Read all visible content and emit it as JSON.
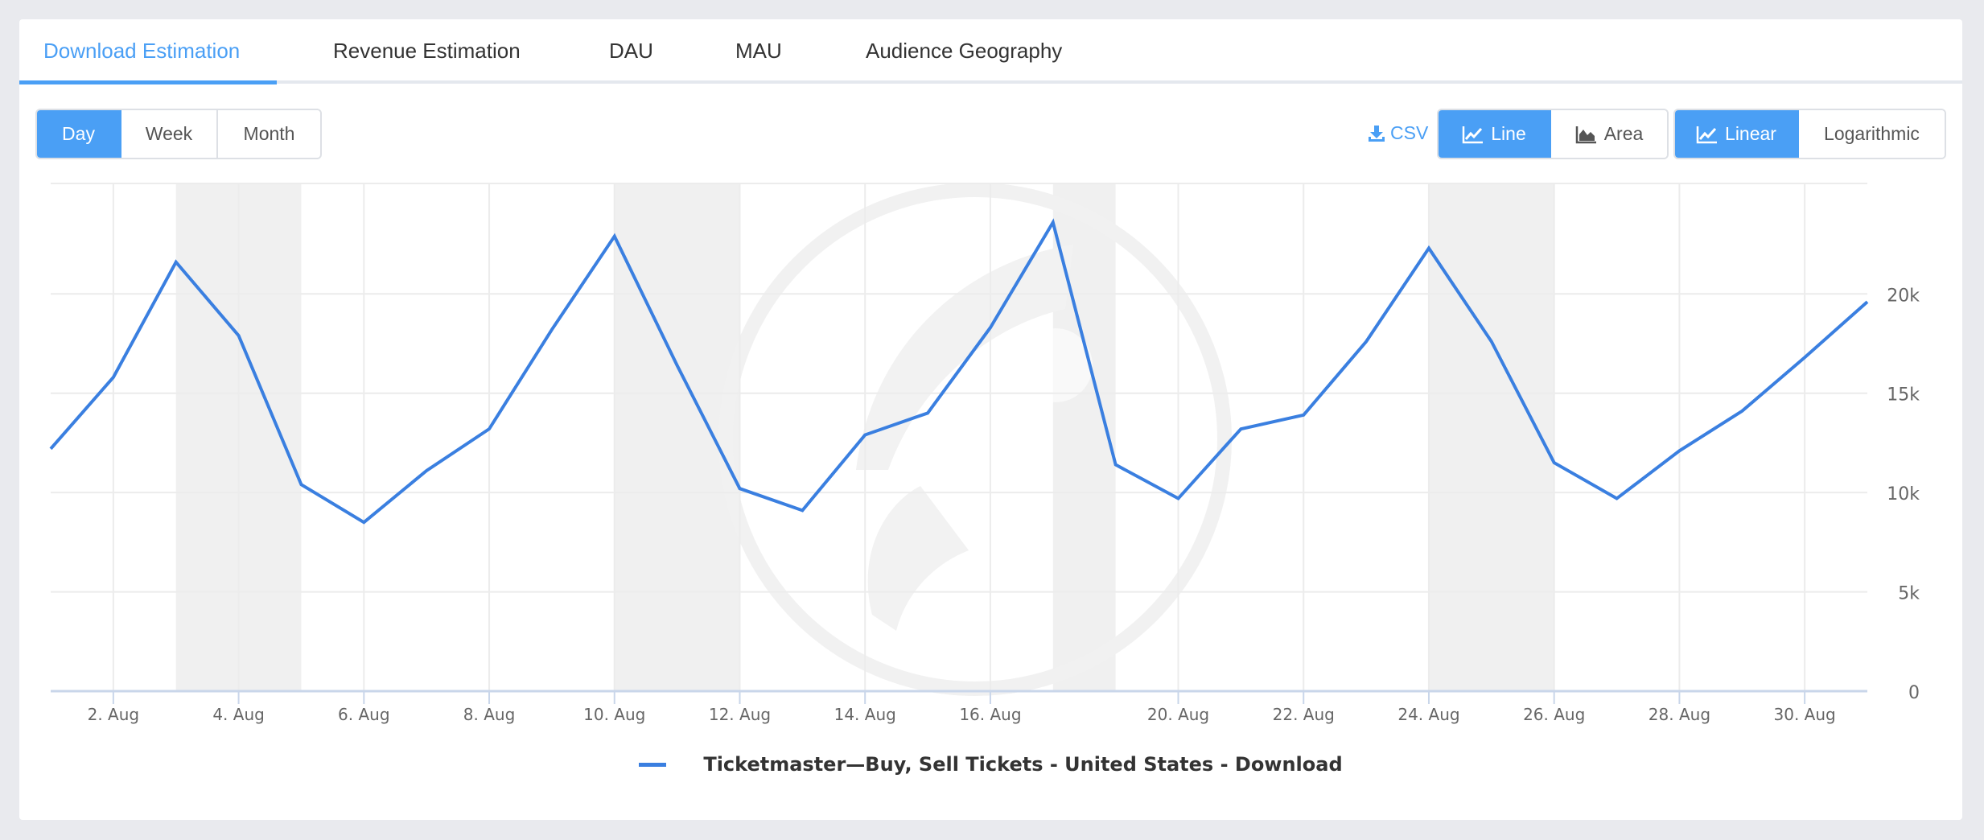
{
  "tabs": [
    {
      "label": "Download Estimation",
      "active": true
    },
    {
      "label": "Revenue Estimation",
      "active": false
    },
    {
      "label": "DAU",
      "active": false
    },
    {
      "label": "MAU",
      "active": false
    },
    {
      "label": "Audience Geography",
      "active": false
    }
  ],
  "period_buttons": [
    {
      "label": "Day",
      "selected": true
    },
    {
      "label": "Week",
      "selected": false
    },
    {
      "label": "Month",
      "selected": false
    }
  ],
  "csv": {
    "label": "CSV",
    "icon": "download-icon"
  },
  "chart_type_buttons": [
    {
      "label": "Line",
      "icon": "line-chart-icon",
      "selected": true
    },
    {
      "label": "Area",
      "icon": "area-chart-icon",
      "selected": false
    }
  ],
  "scale_buttons": [
    {
      "label": "Linear",
      "icon": "line-chart-icon",
      "selected": true
    },
    {
      "label": "Logarithmic",
      "selected": false
    }
  ],
  "colors": {
    "accent": "#4a9ff5",
    "series": "#3a7fe0",
    "weekend_band": "#f0f0f0"
  },
  "chart_data": {
    "type": "line",
    "title": "",
    "xlabel": "",
    "ylabel": "",
    "x": [
      "1 Aug",
      "2 Aug",
      "3 Aug",
      "4 Aug",
      "5 Aug",
      "6 Aug",
      "7 Aug",
      "8 Aug",
      "9 Aug",
      "10 Aug",
      "11 Aug",
      "12 Aug",
      "13 Aug",
      "14 Aug",
      "15 Aug",
      "16 Aug",
      "17 Aug",
      "19 Aug",
      "20 Aug",
      "21 Aug",
      "22 Aug",
      "23 Aug",
      "24 Aug",
      "25 Aug",
      "26 Aug",
      "27 Aug",
      "28 Aug",
      "29 Aug",
      "30 Aug",
      "31 Aug"
    ],
    "x_tick_labels": [
      "2. Aug",
      "4. Aug",
      "6. Aug",
      "8. Aug",
      "10. Aug",
      "12. Aug",
      "14. Aug",
      "16. Aug",
      "20. Aug",
      "22. Aug",
      "24. Aug",
      "26. Aug",
      "28. Aug",
      "30. Aug"
    ],
    "x_tick_indices": [
      1,
      3,
      5,
      7,
      9,
      11,
      13,
      15,
      18,
      20,
      22,
      24,
      26,
      28
    ],
    "series": [
      {
        "name": "Ticketmaster—Buy, Sell Tickets - United States - Download",
        "values": [
          12200,
          15800,
          21600,
          17900,
          10400,
          8500,
          11100,
          13200,
          18200,
          22900,
          16400,
          10200,
          9100,
          12900,
          14000,
          18300,
          23600,
          11400,
          9700,
          13200,
          13900,
          17600,
          22300,
          17600,
          11500,
          9700,
          12100,
          14100,
          16800,
          19600
        ]
      }
    ],
    "weekend_bands": [
      [
        2,
        3
      ],
      [
        9,
        10
      ],
      [
        16,
        16
      ],
      [
        22,
        23
      ]
    ],
    "y_ticks": [
      0,
      5000,
      10000,
      15000,
      20000
    ],
    "y_tick_labels": [
      "0",
      "5k",
      "10k",
      "15k",
      "20k"
    ],
    "ylim": [
      0,
      25000
    ],
    "y_axis_side": "right",
    "grid": true,
    "legend": "bottom-center"
  }
}
